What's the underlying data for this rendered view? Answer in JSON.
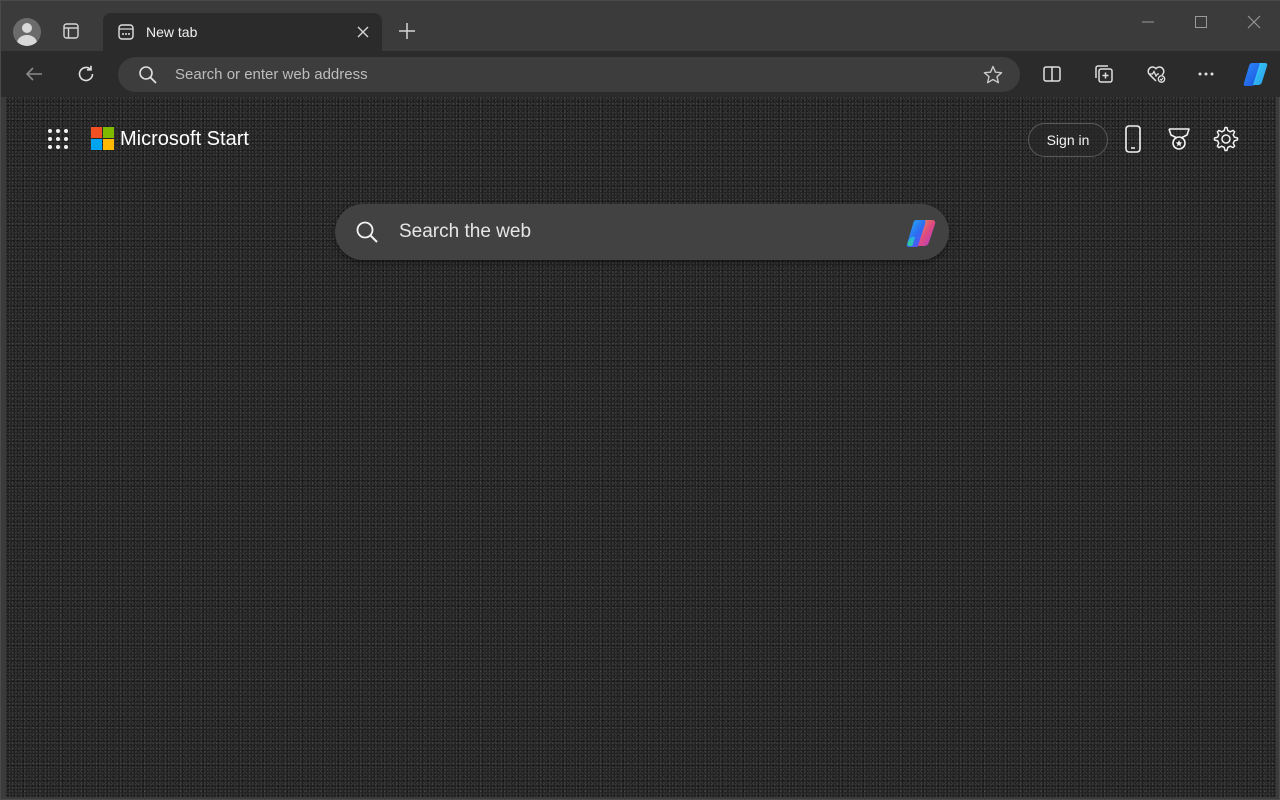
{
  "tab": {
    "title": "New tab"
  },
  "toolbar": {
    "address_placeholder": "Search or enter web address"
  },
  "page": {
    "brand": "Microsoft Start",
    "signin_label": "Sign in",
    "search_placeholder": "Search the web"
  },
  "icons": {
    "profile": "profile-avatar-icon",
    "tab_actions": "tab-actions-icon",
    "favicon": "new-tab-page-icon",
    "tab_close": "close-icon",
    "new_tab": "plus-icon",
    "minimize": "minimize-icon",
    "maximize": "maximize-icon",
    "close_window": "close-icon",
    "back": "back-arrow-icon",
    "refresh": "refresh-icon",
    "search": "search-icon",
    "favorite": "star-icon",
    "split_screen": "split-screen-icon",
    "collections": "collections-icon",
    "browser_essentials": "heart-pulse-icon",
    "more": "more-icon",
    "copilot": "copilot-icon",
    "app_launcher": "app-launcher-icon",
    "phone": "phone-icon",
    "rewards": "rewards-trophy-icon",
    "settings": "gear-icon"
  },
  "colors": {
    "window_frame": "#3b3b3b",
    "toolbar": "#2b2b2b",
    "address_bar": "#3d3d3d",
    "search_box": "#424242",
    "text": "#e8e8e8"
  }
}
